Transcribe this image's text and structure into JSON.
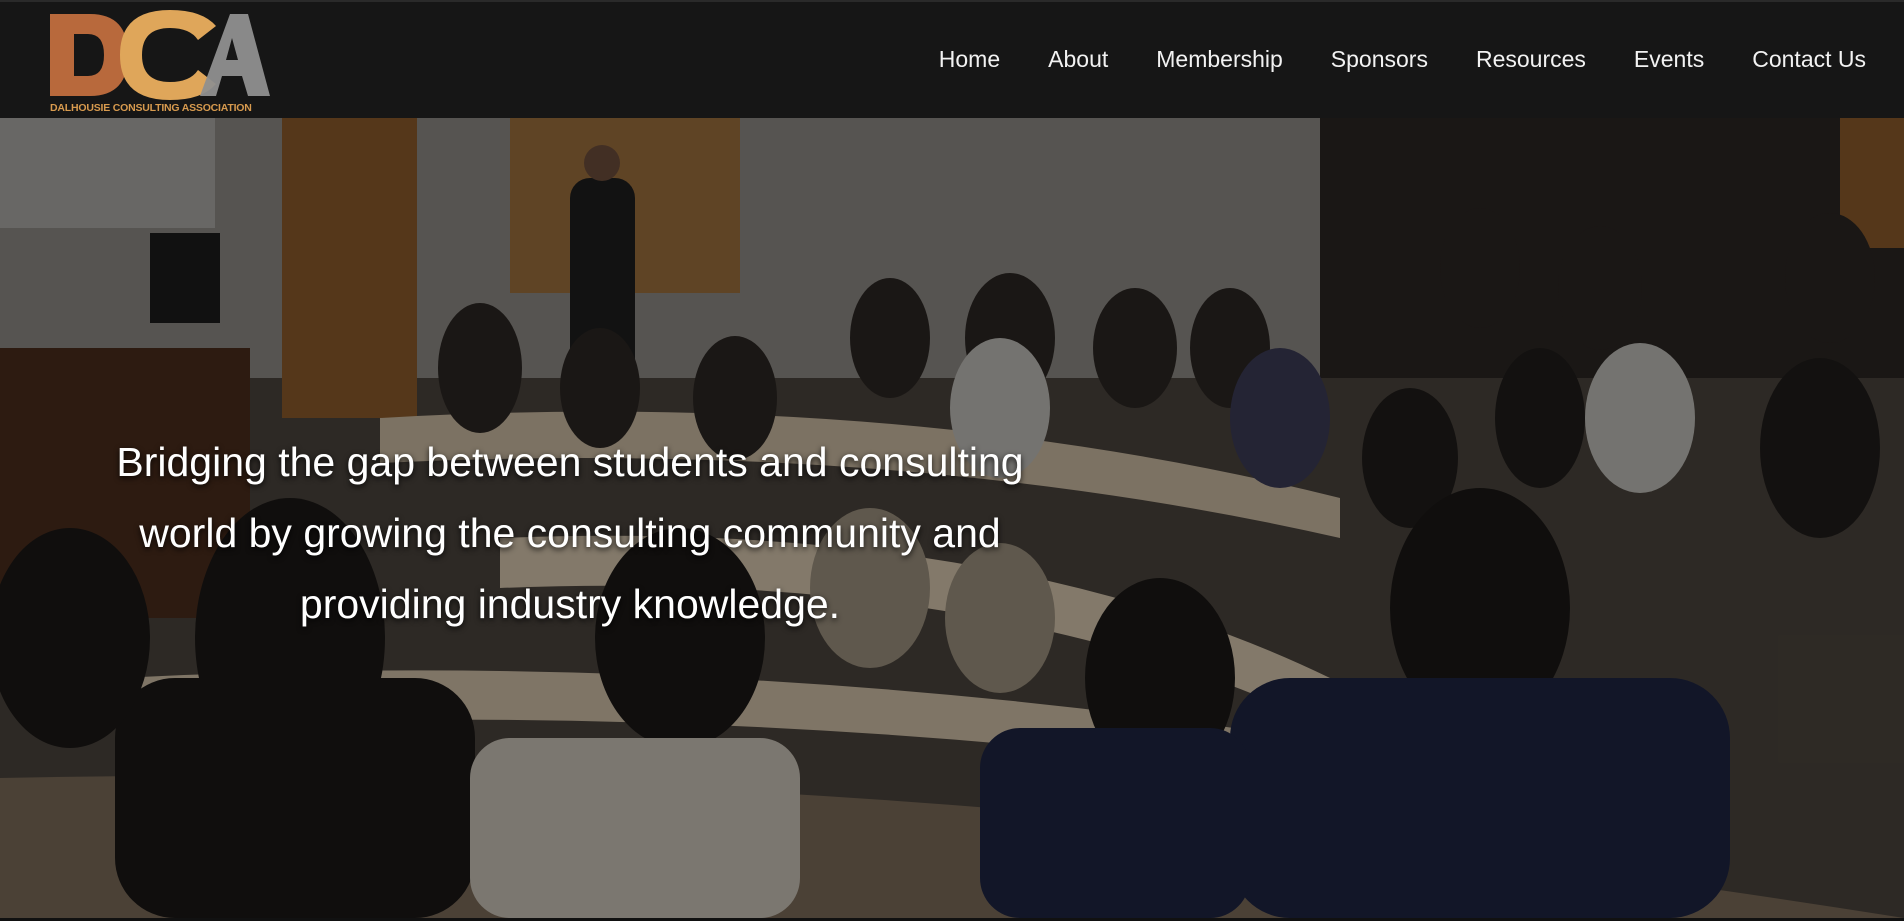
{
  "brand": {
    "logo_letters": "DCA",
    "logo_tagline": "DALHOUSIE CONSULTING ASSOCIATION",
    "colors": {
      "d": "#b8693c",
      "c": "#dfa65a",
      "a": "#8f8f8f",
      "tagline": "#d79a4e"
    }
  },
  "nav": {
    "items": [
      {
        "label": "Home"
      },
      {
        "label": "About"
      },
      {
        "label": "Membership"
      },
      {
        "label": "Sponsors"
      },
      {
        "label": "Resources"
      },
      {
        "label": "Events"
      },
      {
        "label": "Contact Us"
      }
    ]
  },
  "hero": {
    "headline": "Bridging the gap between students and consulting world by growing the consulting community and providing industry knowledge.",
    "image_semantic": "lecture-hall-audience-photo"
  },
  "theme": {
    "header_bg": "#161616",
    "nav_text": "#f2f2f2",
    "hero_text": "#ffffff"
  }
}
